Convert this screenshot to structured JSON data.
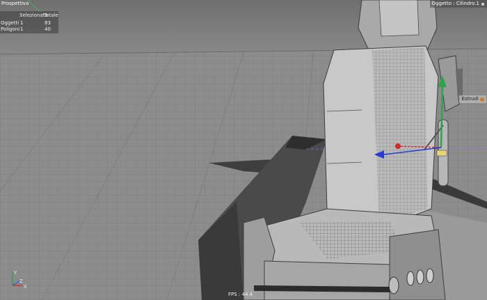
{
  "viewport": {
    "view_name": "Prospettiva",
    "fps_label": "FPS : 44.4"
  },
  "stats": {
    "header_selected": "Selezionato",
    "header_total": "Totale",
    "rows": [
      {
        "label": "Oggetti",
        "selected": "1",
        "total": "83"
      },
      {
        "label": "Poligoni",
        "selected": "1",
        "total": "40"
      }
    ]
  },
  "object_info": {
    "text": "Oggetto : Cilindro.1",
    "icon": "lock-icon"
  },
  "tool_tag": {
    "text": "Estrudi",
    "icon": "extrude-icon"
  },
  "axis_gizmo": {
    "y": "Y",
    "z": "Z",
    "x": "X"
  },
  "colors": {
    "background": "#8a8a8a",
    "seat": "#c6c6c6",
    "seat_dark": "#5d5d5d",
    "handle_y": "#2fa34a",
    "handle_x": "#d22a2a",
    "handle_z": "#2a39d2"
  }
}
